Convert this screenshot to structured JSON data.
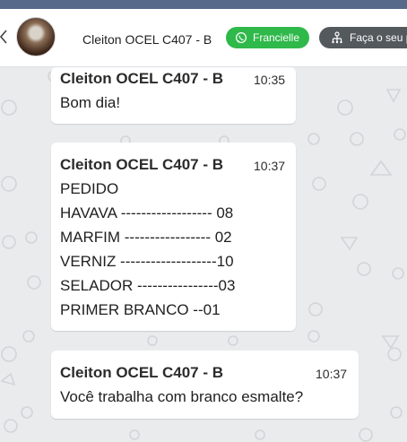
{
  "header": {
    "contact_name": "Cleiton OCEL C407 - B",
    "agent_button_label": "Francielle",
    "flow_button_label": "Faça o seu p"
  },
  "messages": [
    {
      "sender": "Cleiton OCEL C407 - B",
      "time": "10:35",
      "lines": [
        "Bom dia!"
      ]
    },
    {
      "sender": "Cleiton OCEL C407 - B",
      "time": "10:37",
      "lines": [
        "PEDIDO",
        "HAVAVA ------------------ 08",
        "MARFIM ----------------- 02",
        "VERNIZ -------------------10",
        "SELADOR ----------------03",
        "PRIMER BRANCO --01"
      ]
    },
    {
      "sender": "Cleiton OCEL C407 - B",
      "time": "10:37",
      "lines": [
        "Você trabalha com branco esmalte?"
      ]
    }
  ],
  "colors": {
    "top_strip": "#56698a",
    "agent_button": "#2fb94a",
    "flow_button": "#54595e",
    "chat_background": "#e9ebec"
  }
}
